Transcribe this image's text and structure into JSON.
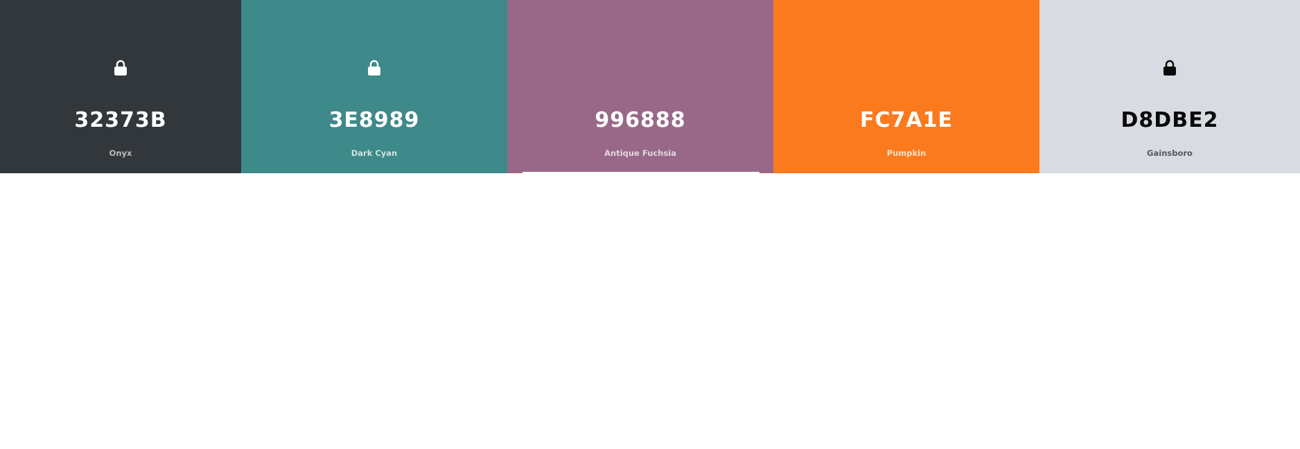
{
  "palette": {
    "swatches": [
      {
        "hex": "32373B",
        "name": "Onyx",
        "color": "#32373B",
        "text_color": "#ffffff",
        "name_color": "#b9bcbf",
        "locked": true
      },
      {
        "hex": "3E8989",
        "name": "Dark Cyan",
        "color": "#3E8989",
        "text_color": "#ffffff",
        "name_color": "#cfe3e3",
        "locked": true
      },
      {
        "hex": "996888",
        "name": "Antique Fuchsia",
        "color": "#996888",
        "text_color": "#ffffff",
        "name_color": "#e3d6df",
        "locked": false
      },
      {
        "hex": "FC7A1E",
        "name": "Pumpkin",
        "color": "#FC7A1E",
        "text_color": "#ffffff",
        "name_color": "#fde0cb",
        "locked": false
      },
      {
        "hex": "D8DBE2",
        "name": "Gainsboro",
        "color": "#D8DBE2",
        "text_color": "#0a0a0a",
        "name_color": "#55585d",
        "locked": true
      }
    ]
  }
}
